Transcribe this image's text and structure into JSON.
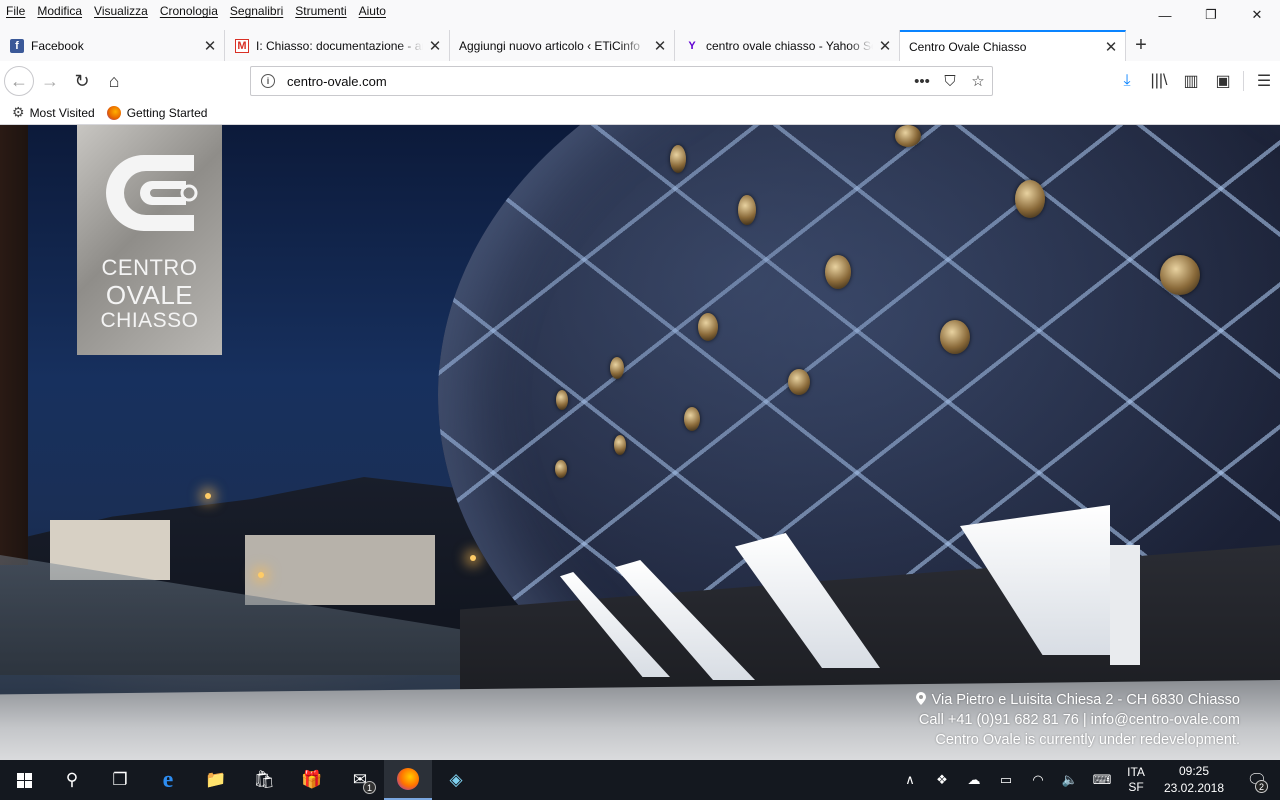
{
  "menubar": {
    "items": [
      "File",
      "Modifica",
      "Visualizza",
      "Cronologia",
      "Segnalibri",
      "Strumenti",
      "Aiuto"
    ],
    "window_controls": {
      "minimize": "—",
      "restore": "❐",
      "close": "✕"
    }
  },
  "tabs": [
    {
      "title": "Facebook",
      "favicon": "facebook-icon",
      "active": false
    },
    {
      "title": "I: Chiasso: documentazione - ar",
      "favicon": "gmail-icon",
      "active": false
    },
    {
      "title": "Aggiungi nuovo articolo ‹ ETiCinfo",
      "favicon": "none",
      "active": false
    },
    {
      "title": "centro ovale chiasso - Yahoo Se",
      "favicon": "yahoo-icon",
      "active": false
    },
    {
      "title": "Centro Ovale Chiasso",
      "favicon": "none",
      "active": true
    }
  ],
  "tab_close_glyph": "✕",
  "new_tab_glyph": "+",
  "nav": {
    "back_glyph": "←",
    "forward_glyph": "→",
    "reload_glyph": "↻",
    "home_glyph": "⌂",
    "url": "centro-ovale.com",
    "info_glyph": "i",
    "page_actions_glyph": "•••",
    "pocket_glyph": "⛉",
    "bookmark_star_glyph": "☆",
    "download_glyph": "⤓",
    "library_glyph": "|||\\",
    "sidebar_glyph": "▥",
    "screenshot_glyph": "▣",
    "menu_glyph": "☰"
  },
  "bookmarks": [
    {
      "label": "Most Visited",
      "icon": "gear-icon",
      "glyph": "⚙"
    },
    {
      "label": "Getting Started",
      "icon": "firefox-icon"
    }
  ],
  "page": {
    "logo": {
      "line1": "CENTRO",
      "line2": "OVALE",
      "line3": "CHIASSO",
      "color": "#f4f4f4"
    },
    "info": {
      "address": "Via Pietro e Luisita Chiesa 2 - CH 6830 Chiasso",
      "contact": "Call +41 (0)91 682 81 76 | info@centro-ovale.com",
      "status": "Centro Ovale is currently under redevelopment."
    }
  },
  "taskbar": {
    "start_icon": "windows-icon",
    "search_glyph": "⚲",
    "taskview_glyph": "❐",
    "edge_glyph": "e",
    "explorer_glyph": "📁",
    "store_glyph": "🛍",
    "gift_glyph": "🎁",
    "mail_glyph": "✉",
    "mail_badge": "1",
    "notepad_glyph": "◈",
    "tray": {
      "chevron_glyph": "∧",
      "dropbox_glyph": "❖",
      "onedrive_glyph": "☁",
      "battery_glyph": "▭",
      "wifi_glyph": "◠",
      "volume_glyph": "🔈",
      "keyboard_glyph": "⌨",
      "lang_line1": "ITA",
      "lang_line2": "SF",
      "time": "09:25",
      "date": "23.02.2018",
      "notifications_glyph": "🗨",
      "notifications_count": "2"
    }
  },
  "colors": {
    "accent": "#0a84ff",
    "taskbar_bg": "#14181f",
    "chrome_bg": "#f9f9fa"
  }
}
